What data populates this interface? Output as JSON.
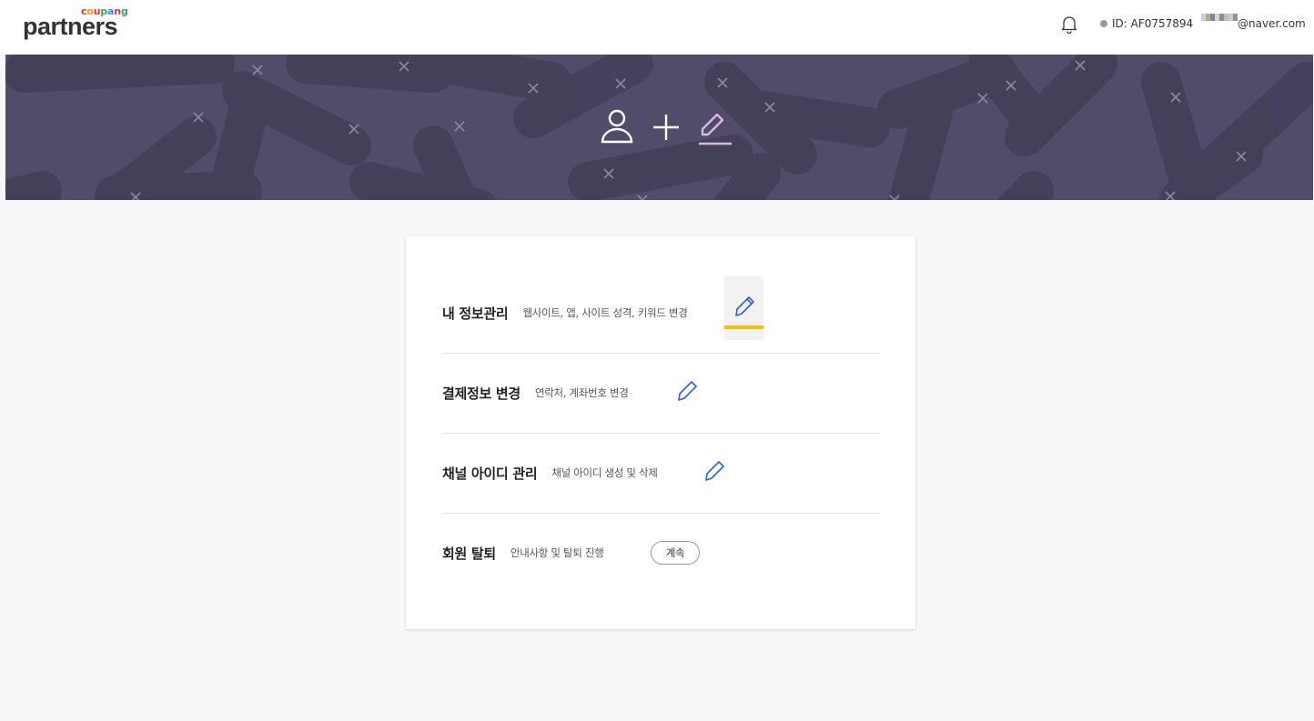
{
  "header": {
    "logo_small": "coupang",
    "logo_big": "partners",
    "logo_colors": [
      "#e3342f",
      "#f39c12",
      "#e3342f",
      "#3aa655",
      "#3b82f6",
      "#e3342f",
      "#3aa655"
    ],
    "user_id": "ID: AF0757894",
    "email": "@naver.com"
  },
  "banner": {
    "background_color": "#524c6b",
    "icons": [
      "user-icon",
      "plus-icon",
      "pencil-icon"
    ]
  },
  "menu": [
    {
      "title": "내 정보관리",
      "description": "웹사이트, 앱, 사이트 성격, 키워드 변경",
      "action": "edit",
      "active": true
    },
    {
      "title": "결제정보 변경",
      "description": "연락처, 계좌번호 변경",
      "action": "edit",
      "active": false
    },
    {
      "title": "채널 아이디 관리",
      "description": "채널 아이디 생성 및 삭제",
      "action": "edit",
      "active": false
    },
    {
      "title": "회원 탈퇴",
      "description": "안내사항 및 탈퇴 진행",
      "action": "button",
      "button_label": "계속"
    }
  ],
  "colors": {
    "accent_yellow": "#f0c000",
    "pencil_blue": "#2f5fd0",
    "banner_pencil": "#d9b8e8"
  }
}
